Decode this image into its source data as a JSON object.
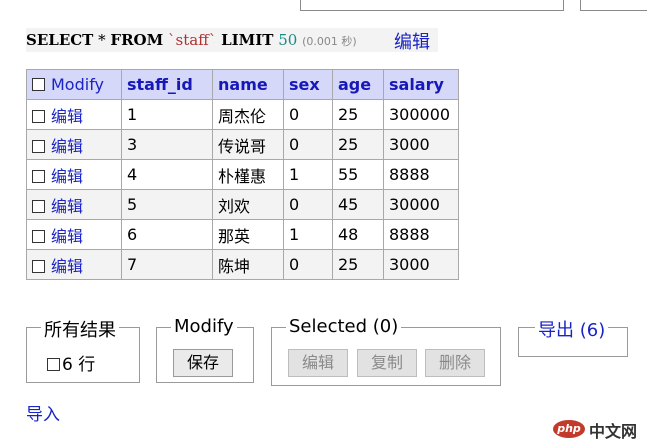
{
  "sql": {
    "select_kw": "SELECT",
    "star": "*",
    "from_kw": "FROM",
    "table_name": "`staff`",
    "limit_kw": "LIMIT",
    "limit_value": "50",
    "time": "(0.001 秒)",
    "edit_label": "编辑"
  },
  "table": {
    "header_checkbox_label": "Modify",
    "columns": [
      "staff_id",
      "name",
      "sex",
      "age",
      "salary"
    ],
    "row_edit_label": "编辑",
    "rows": [
      [
        "1",
        "周杰伦",
        "0",
        "25",
        "300000"
      ],
      [
        "3",
        "传说哥",
        "0",
        "25",
        "3000"
      ],
      [
        "4",
        "朴槿惠",
        "1",
        "55",
        "8888"
      ],
      [
        "5",
        "刘欢",
        "0",
        "45",
        "30000"
      ],
      [
        "6",
        "那英",
        "1",
        "48",
        "8888"
      ],
      [
        "7",
        "陈坤",
        "0",
        "25",
        "3000"
      ]
    ]
  },
  "all_results": {
    "legend": "所有结果",
    "count_text": "6 行"
  },
  "modify_panel": {
    "legend": "Modify",
    "save_label": "保存"
  },
  "selected_panel": {
    "legend": "Selected (0)",
    "edit_label": "编辑",
    "copy_label": "复制",
    "delete_label": "删除"
  },
  "export_panel": {
    "legend": "导出 (6)"
  },
  "import_link": "导入",
  "watermark": {
    "logo_text": "php",
    "site_text": "中文网"
  },
  "colors": {
    "link": "#1a23c4",
    "header_bg": "#d5d8f9",
    "header_text": "#1818b8",
    "watermark_red": "#c23a2a"
  }
}
